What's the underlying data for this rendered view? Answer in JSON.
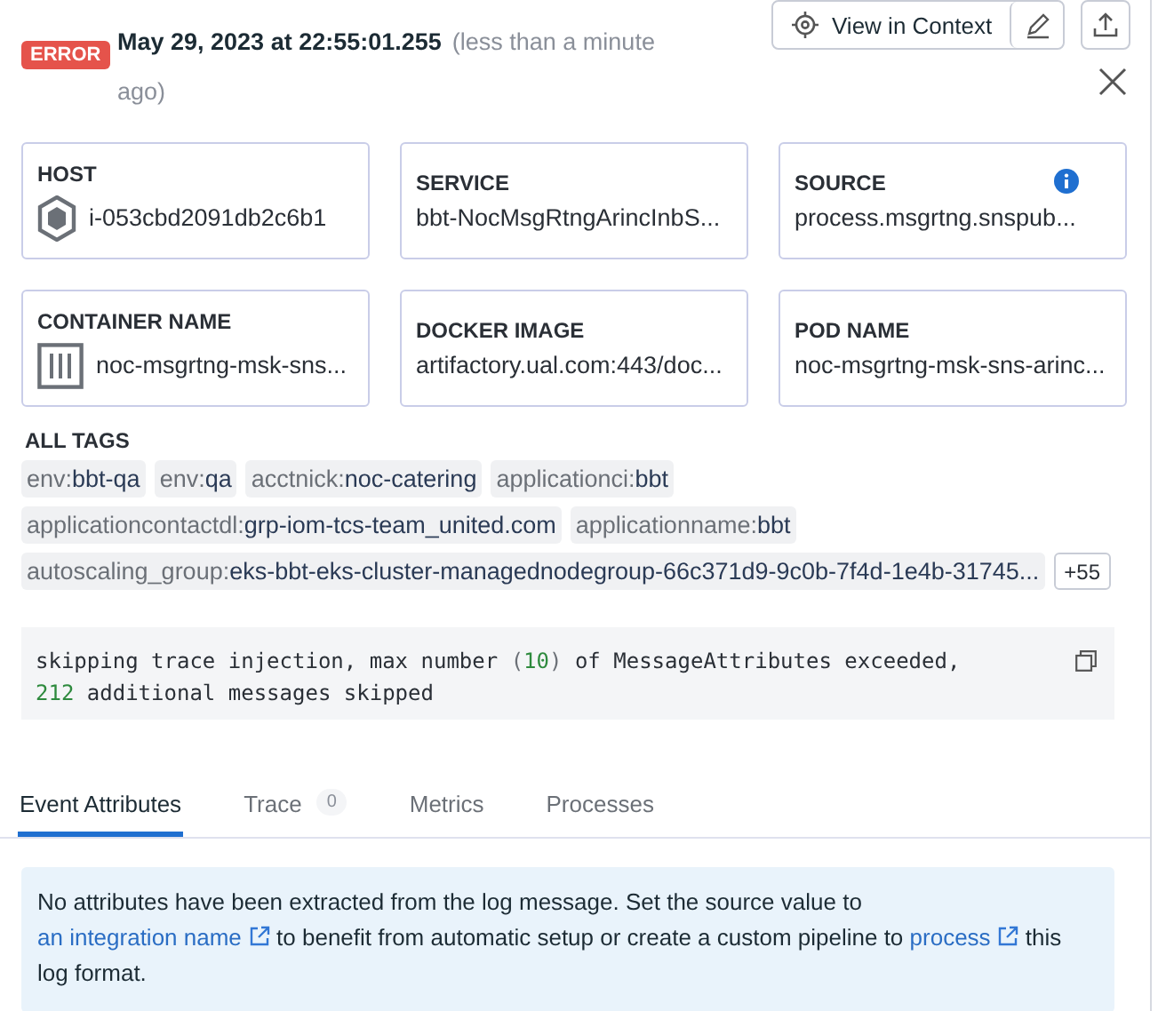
{
  "header": {
    "status": "ERROR",
    "timestamp": "May 29, 2023 at 22:55:01.255",
    "relative": "(less than a minute ago)",
    "context_button": "View in Context"
  },
  "cards": [
    {
      "label": "HOST",
      "value": "i-053cbd2091db2c6b1",
      "kind": "host",
      "info": false
    },
    {
      "label": "SERVICE",
      "value": "bbt-NocMsgRtngArincInbS...",
      "kind": "plain",
      "info": false
    },
    {
      "label": "SOURCE",
      "value": "process.msgrtng.snspub...",
      "kind": "plain",
      "info": true
    },
    {
      "label": "CONTAINER NAME",
      "value": "noc-msgrtng-msk-sns...",
      "kind": "container",
      "info": false
    },
    {
      "label": "DOCKER IMAGE",
      "value": "artifactory.ual.com:443/doc...",
      "kind": "plain",
      "info": false
    },
    {
      "label": "POD NAME",
      "value": "noc-msgrtng-msk-sns-arinc...",
      "kind": "plain",
      "info": false
    }
  ],
  "tags": {
    "title": "ALL TAGS",
    "items": [
      {
        "key": "env:",
        "value": "bbt-qa"
      },
      {
        "key": "env:",
        "value": "qa"
      },
      {
        "key": "acctnick:",
        "value": "noc-catering"
      },
      {
        "key": "applicationci:",
        "value": "bbt"
      },
      {
        "key": "applicationcontactdl:",
        "value": "grp-iom-tcs-team_united.com"
      },
      {
        "key": "applicationname:",
        "value": "bbt"
      },
      {
        "key": "autoscaling_group:",
        "value": "eks-bbt-eks-cluster-managednodegroup-66c371d9-9c0b-7f4d-1e4b-31745..."
      }
    ],
    "more": "+55"
  },
  "message": [
    {
      "kind": "text",
      "text": "skipping trace injection, max number "
    },
    {
      "kind": "punct",
      "text": "("
    },
    {
      "kind": "number",
      "text": "10"
    },
    {
      "kind": "punct",
      "text": ")"
    },
    {
      "kind": "text",
      "text": " of MessageAttributes exceeded,\n"
    },
    {
      "kind": "number",
      "text": "212"
    },
    {
      "kind": "text",
      "text": " additional messages skipped"
    }
  ],
  "tabs": [
    {
      "label": "Event Attributes",
      "selected": true
    },
    {
      "label": "Trace",
      "count": "0",
      "selected": false
    },
    {
      "label": "Metrics",
      "selected": false
    },
    {
      "label": "Processes",
      "selected": false
    }
  ],
  "notice": [
    {
      "kind": "text",
      "text": "No attributes have been extracted from the log message. Set the source value to "
    },
    {
      "kind": "link",
      "text": "an integration name"
    },
    {
      "kind": "text",
      "text": " to benefit from automatic setup or create a custom pipeline to "
    },
    {
      "kind": "link",
      "text": "process"
    },
    {
      "kind": "text",
      "text": " this log format."
    }
  ]
}
